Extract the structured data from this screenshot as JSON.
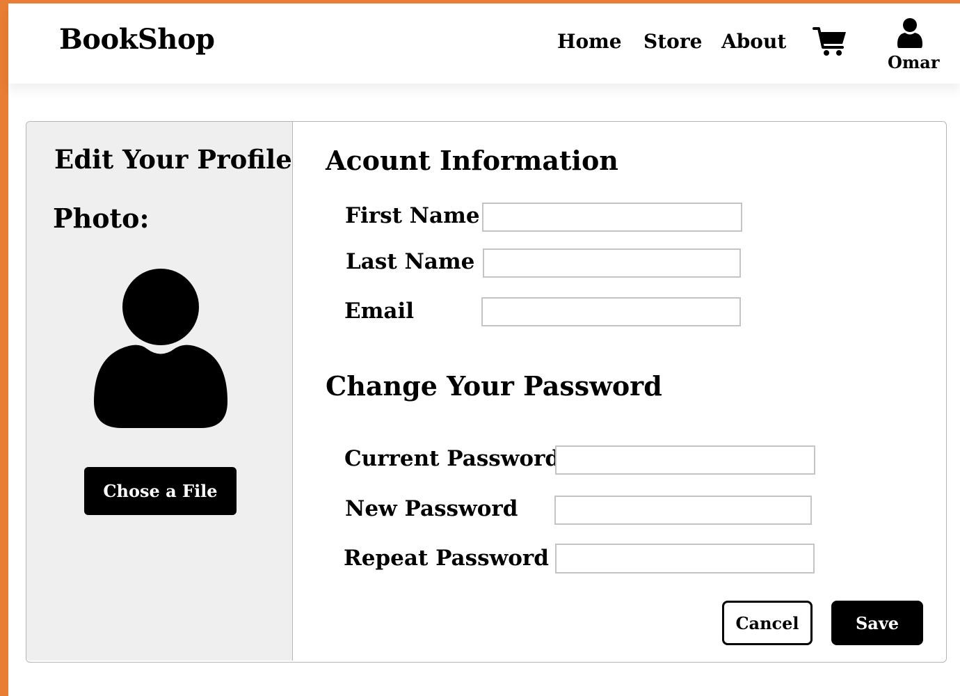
{
  "colors": {
    "frame_accent": "#e87d34",
    "left_panel_bg": "#efefef",
    "input_border": "#c4c4c4",
    "primary_button": "#000000"
  },
  "header": {
    "brand": "BookShop",
    "nav": {
      "home": "Home",
      "store": "Store",
      "about": "About"
    },
    "cart_icon": "shopping-cart-icon",
    "user_icon": "user-icon",
    "user_name": "Omar"
  },
  "sidebar": {
    "title": "Edit Your Profile",
    "photo_label": "Photo:",
    "avatar_icon": "user-silhouette-icon",
    "choose_file_label": "Chose a File"
  },
  "account": {
    "title": "Acount Information",
    "first_name_label": "First Name",
    "first_name_value": "",
    "last_name_label": "Last Name",
    "last_name_value": "",
    "email_label": "Email",
    "email_value": ""
  },
  "password": {
    "title": "Change Your Password",
    "current_label": "Current Password",
    "current_value": "",
    "new_label": "New Password",
    "new_value": "",
    "repeat_label": "Repeat Password",
    "repeat_value": ""
  },
  "actions": {
    "cancel_label": "Cancel",
    "save_label": "Save"
  }
}
